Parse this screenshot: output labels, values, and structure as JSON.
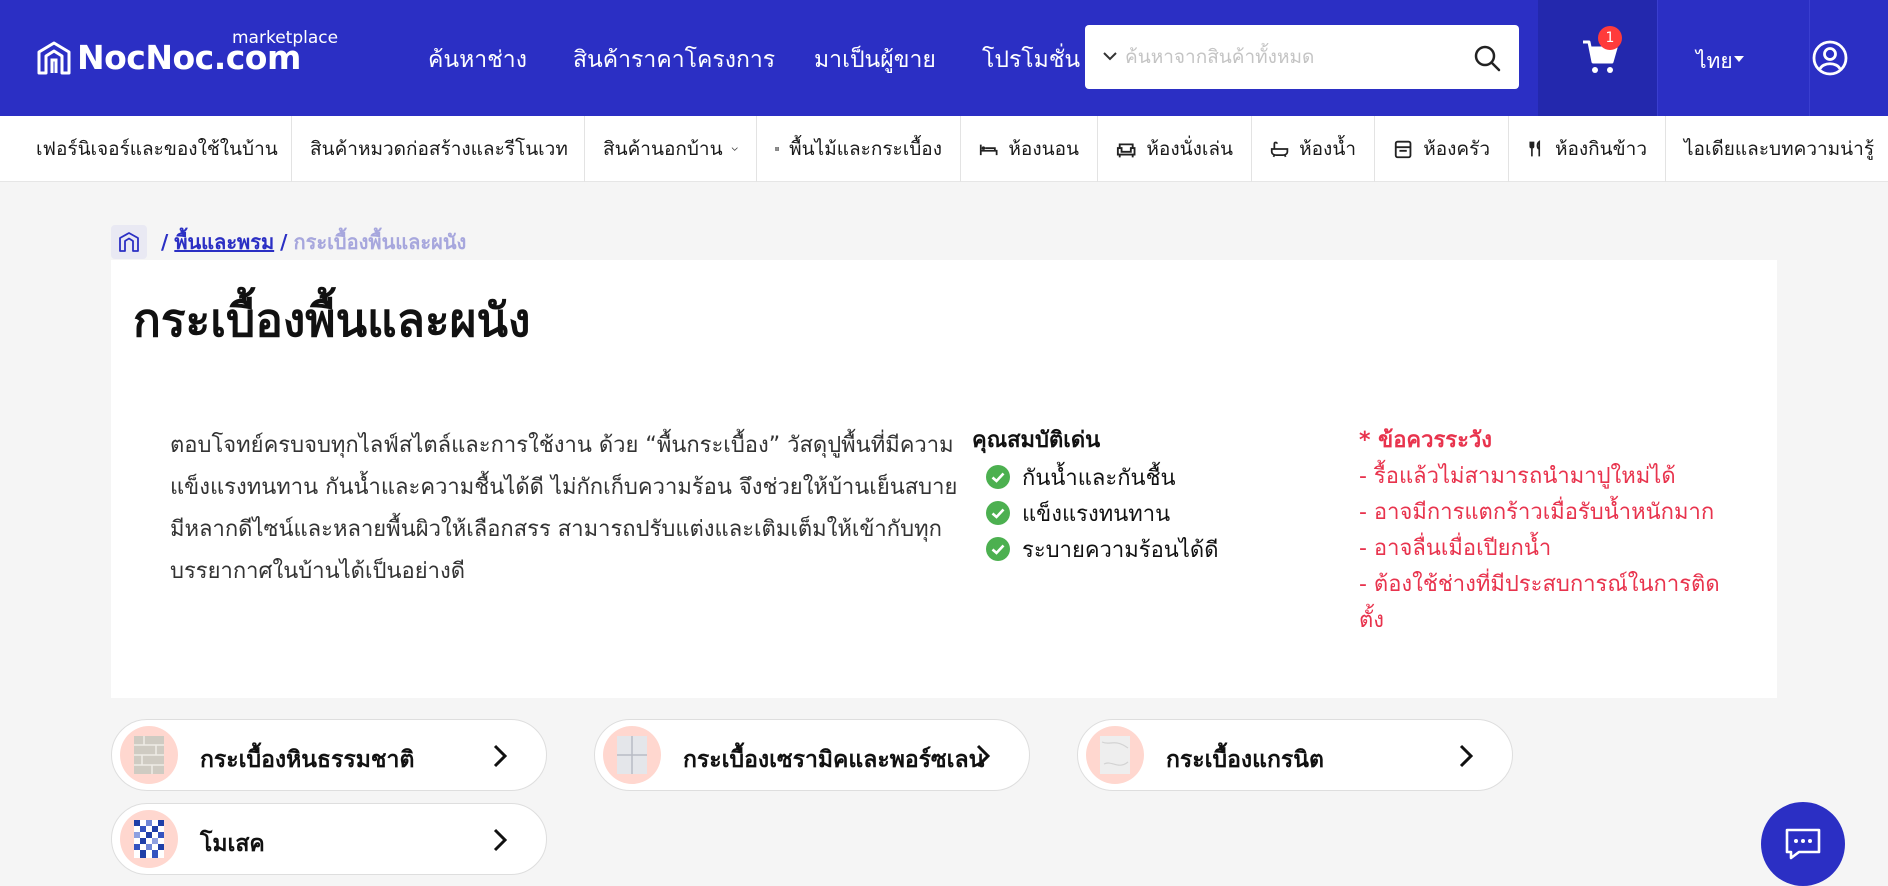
{
  "header": {
    "logo_text": "NocNoc.com",
    "logo_sub": "marketplace",
    "nav": [
      "ค้นหาช่าง",
      "สินค้าราคาโครงการ",
      "มาเป็นผู้ขาย",
      "โปรโมชั่น"
    ],
    "search_placeholder": "ค้นหาจากสินค้าทั้งหมด",
    "cart_count": "1",
    "language": "ไทย",
    "colors": {
      "primary": "#2b2fc4",
      "cart_bg": "#2328ad",
      "badge": "#ff3b3b"
    }
  },
  "categories": [
    {
      "label": "เฟอร์นิเจอร์และของใช้ในบ้าน",
      "icon": "",
      "dropdown": true
    },
    {
      "label": "สินค้าหมวดก่อสร้างและรีโนเวท",
      "icon": "",
      "dropdown": true
    },
    {
      "label": "สินค้านอกบ้าน",
      "icon": "",
      "dropdown": true
    },
    {
      "label": "พื้นไม้และกระเบื้อง",
      "icon": "tile-grid-icon",
      "dropdown": false
    },
    {
      "label": "ห้องนอน",
      "icon": "bed-icon",
      "dropdown": false
    },
    {
      "label": "ห้องนั่งเล่น",
      "icon": "sofa-icon",
      "dropdown": false
    },
    {
      "label": "ห้องน้ำ",
      "icon": "bathtub-icon",
      "dropdown": false
    },
    {
      "label": "ห้องครัว",
      "icon": "stove-icon",
      "dropdown": false
    },
    {
      "label": "ห้องกินข้าว",
      "icon": "utensils-icon",
      "dropdown": false
    },
    {
      "label": "ไอเดียและบทความน่ารู้",
      "icon": "",
      "dropdown": false
    }
  ],
  "breadcrumb": {
    "home_icon": "home-icon",
    "separator": "/",
    "parent": "พื้นและพรม",
    "current": "กระเบื้องพื้นและผนัง"
  },
  "page": {
    "title": "กระเบื้องพื้นและผนัง",
    "description_lines": [
      "ตอบโจทย์ครบจบทุกไลฟ์สไตล์และการใช้งาน ด้วย “พื้นกระเบื้อง” วัสดุปูพื้นที่มีความ",
      "แข็งแรงทนทาน กันน้ำและความชื้นได้ดี ไม่กักเก็บความร้อน จึงช่วยให้บ้านเย็นสบาย",
      "มีหลากดีไซน์และหลายพื้นผิวให้เลือกสรร สามารถปรับแต่งและเติมเต็มให้เข้ากับทุก",
      "บรรยากาศในบ้านได้เป็นอย่างดี"
    ],
    "features_title": "คุณสมบัติเด่น",
    "features": [
      "กันน้ำและกันชื้น",
      "แข็งแรงทนทาน",
      "ระบายความร้อนได้ดี"
    ],
    "warnings_title": "* ข้อควรระวัง",
    "warnings": [
      "- รื้อแล้วไม่สามารถนำมาปูใหม่ได้",
      "- อาจมีการแตกร้าวเมื่อรับน้ำหนักมาก",
      "- อาจลื่นเมื่อเปียกน้ำ",
      "- ต้องใช้ช่างที่มีประสบการณ์ในการติด",
      "ตั้ง"
    ],
    "colors": {
      "check": "#4cb050",
      "warning": "#e8334d"
    }
  },
  "subcategories": [
    {
      "label": "กระเบื้องหินธรรมชาติ",
      "thumb": "stone-tile-thumbnail"
    },
    {
      "label": "กระเบื้องเซรามิคและพอร์ซเลน",
      "thumb": "ceramic-tile-thumbnail"
    },
    {
      "label": "กระเบื้องแกรนิต",
      "thumb": "granite-tile-thumbnail"
    },
    {
      "label": "โมเสค",
      "thumb": "mosaic-tile-thumbnail"
    }
  ],
  "chat_icon": "chat-icon"
}
